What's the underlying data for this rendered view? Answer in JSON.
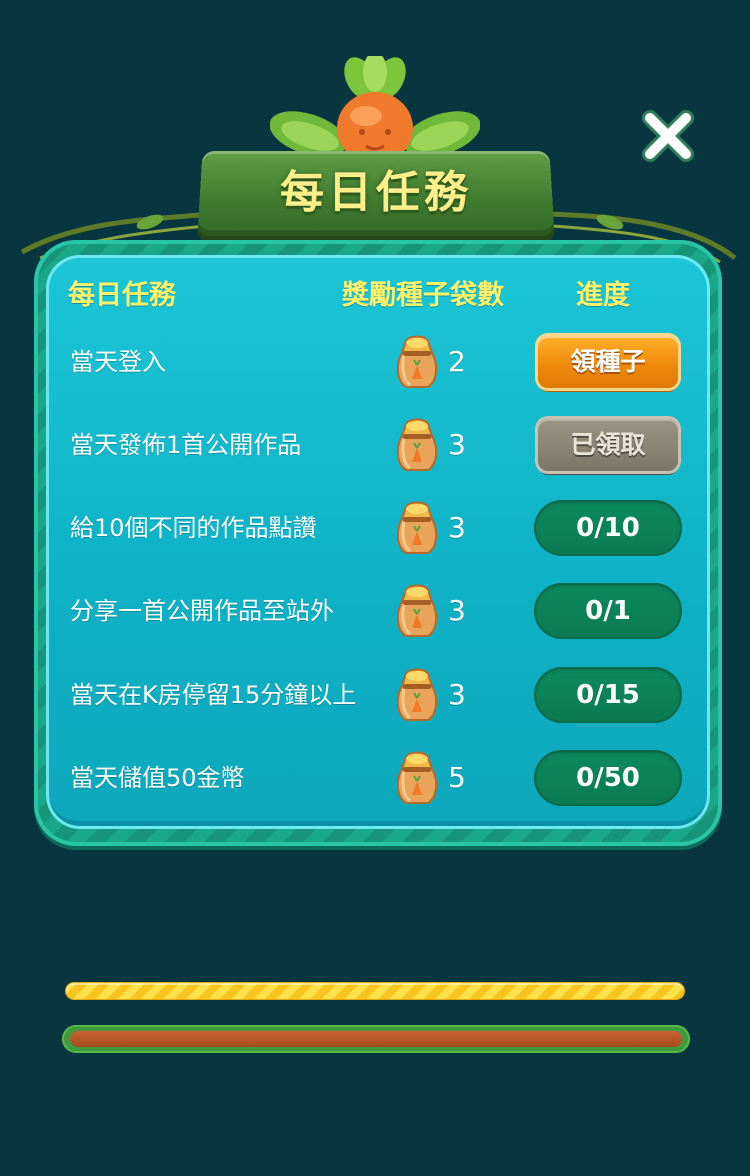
{
  "dialog": {
    "title": "每日任務",
    "close_icon": "close-x-icon"
  },
  "table": {
    "headers": {
      "task": "每日任務",
      "reward": "獎勵種子袋數",
      "progress": "進度"
    },
    "rows": [
      {
        "task": "當天登入",
        "reward": "2",
        "status": "claim",
        "action": "領種子"
      },
      {
        "task": "當天發佈1首公開作品",
        "reward": "3",
        "status": "claimed",
        "action": "已領取"
      },
      {
        "task": "給10個不同的作品點讚",
        "reward": "3",
        "status": "progress",
        "action": "0/10"
      },
      {
        "task": "分享一首公開作品至站外",
        "reward": "3",
        "status": "progress",
        "action": "0/1"
      },
      {
        "task": "當天在K房停留15分鐘以上",
        "reward": "3",
        "status": "progress",
        "action": "0/15"
      },
      {
        "task": "當天儲值50金幣",
        "reward": "5",
        "status": "progress",
        "action": "0/50"
      }
    ]
  },
  "colors": {
    "background": "#083640",
    "panel": "#0fb2c6",
    "header_text": "#fff26a",
    "claim_button": "#f08a0c",
    "claimed_button": "#8a8474",
    "progress_pill": "#0a7a52"
  },
  "icons": [
    "close-x-icon",
    "carrot-icon",
    "seed-bag-icon"
  ]
}
